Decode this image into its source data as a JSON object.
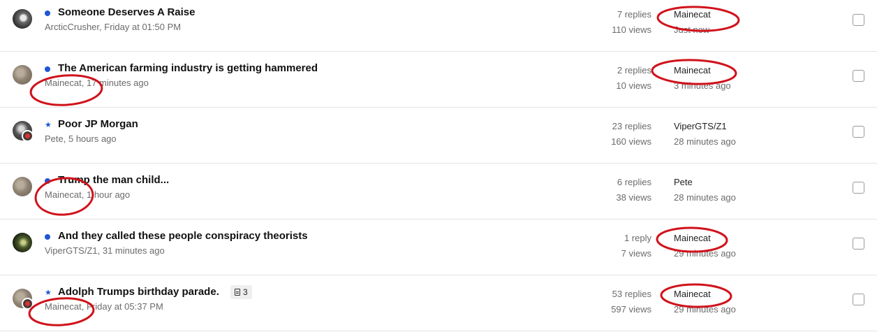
{
  "threads": [
    {
      "marker": "dot",
      "title": "Someone Deserves A Raise",
      "author": "ArcticCrusher",
      "started": ", Friday at 01:50 PM",
      "replies": "7 replies",
      "views": "110 views",
      "last_user": "Mainecat",
      "last_time": "Just now",
      "avatar": "arctic"
    },
    {
      "marker": "dot",
      "title": "The American farming industry is getting hammered",
      "author": "Mainecat",
      "started": ", 17 minutes ago",
      "replies": "2 replies",
      "views": "10 views",
      "last_user": "Mainecat",
      "last_time": "3 minutes ago",
      "avatar": "mainecat"
    },
    {
      "marker": "star",
      "title": "Poor JP Morgan",
      "author": "Pete",
      "started": ", 5 hours ago",
      "replies": "23 replies",
      "views": "160 views",
      "last_user": "ViperGTS/Z1",
      "last_time": "28 minutes ago",
      "avatar": "pete"
    },
    {
      "marker": "dot",
      "title": "Trump the man child...",
      "author": "Mainecat",
      "started": ", 1 hour ago",
      "replies": "6 replies",
      "views": "38 views",
      "last_user": "Pete",
      "last_time": "28 minutes ago",
      "avatar": "mainecat"
    },
    {
      "marker": "dot",
      "title": "And they called these people conspiracy theorists",
      "author": "ViperGTS/Z1",
      "started": ", 31 minutes ago",
      "replies": "1 reply",
      "views": "7 views",
      "last_user": "Mainecat",
      "last_time": "29 minutes ago",
      "avatar": "viper"
    },
    {
      "marker": "star",
      "title": "Adolph Trumps birthday parade.",
      "attachments": "3",
      "author": "Mainecat",
      "started": ", Friday at 05:37 PM",
      "replies": "53 replies",
      "views": "597 views",
      "last_user": "Mainecat",
      "last_time": "29 minutes ago",
      "avatar": "mainecat"
    }
  ],
  "colors": {
    "unread_dot": "#1e56d6",
    "annotation": "#d0121b",
    "divider": "#e3e3e3"
  },
  "icons": {
    "unread": "dot",
    "featured": "star",
    "attachment": "document-icon"
  }
}
